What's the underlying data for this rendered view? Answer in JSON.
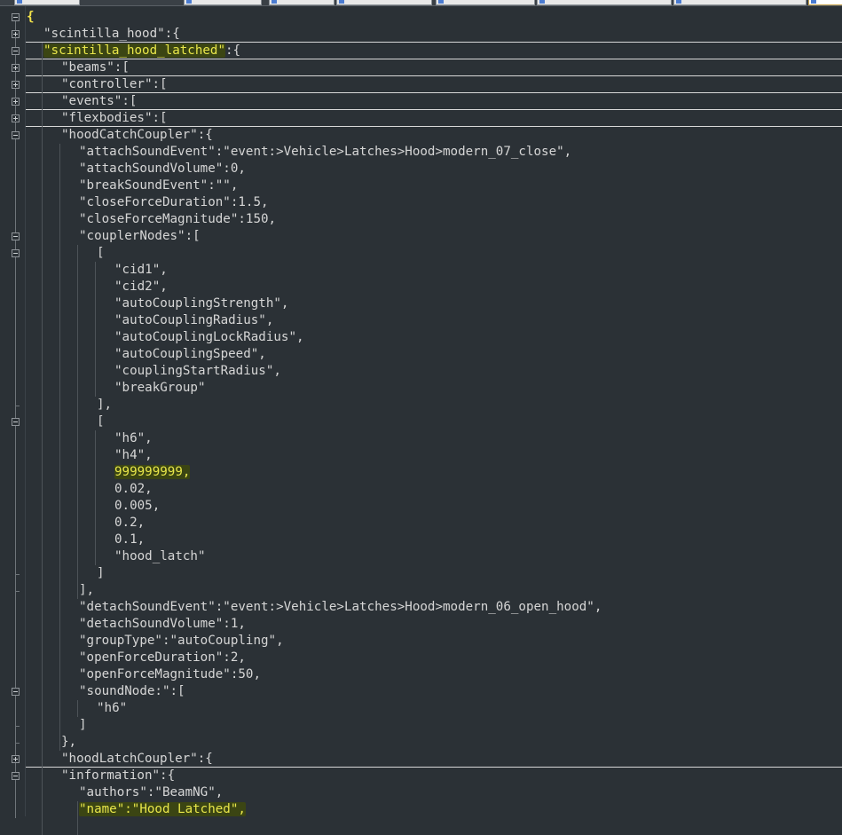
{
  "editor": {
    "lines": [
      {
        "text": "{",
        "indent": 0,
        "fold": "minus",
        "kind": "bracket-match"
      },
      {
        "text": "\"scintilla_hood\":{",
        "indent": 1,
        "fold": "plus"
      },
      {
        "text": "\"scintilla_hood_latched\":{",
        "indent": 1,
        "fold": "minus",
        "highlight": "\"scintilla_hood_latched\"",
        "rest": ":{",
        "boxed": true
      },
      {
        "text": "\"beams\":[",
        "indent": 2,
        "fold": "plus",
        "boxed": true
      },
      {
        "text": "\"controller\":[",
        "indent": 2,
        "fold": "plus",
        "boxed": true
      },
      {
        "text": "\"events\":[",
        "indent": 2,
        "fold": "plus",
        "boxed": true
      },
      {
        "text": "\"flexbodies\":[",
        "indent": 2,
        "fold": "plus",
        "boxed": true
      },
      {
        "text": "\"hoodCatchCoupler\":{",
        "indent": 2,
        "fold": "minus",
        "boxed": true
      },
      {
        "text": "\"attachSoundEvent\":\"event:>Vehicle>Latches>Hood>modern_07_close\",",
        "indent": 3
      },
      {
        "text": "\"attachSoundVolume\":0,",
        "indent": 3
      },
      {
        "text": "\"breakSoundEvent\":\"\",",
        "indent": 3
      },
      {
        "text": "\"closeForceDuration\":1.5,",
        "indent": 3
      },
      {
        "text": "\"closeForceMagnitude\":150,",
        "indent": 3
      },
      {
        "text": "\"couplerNodes\":[",
        "indent": 3,
        "fold": "minus"
      },
      {
        "text": "[",
        "indent": 4,
        "fold": "minus"
      },
      {
        "text": "\"cid1\",",
        "indent": 5
      },
      {
        "text": "\"cid2\",",
        "indent": 5
      },
      {
        "text": "\"autoCouplingStrength\",",
        "indent": 5
      },
      {
        "text": "\"autoCouplingRadius\",",
        "indent": 5
      },
      {
        "text": "\"autoCouplingLockRadius\",",
        "indent": 5
      },
      {
        "text": "\"autoCouplingSpeed\",",
        "indent": 5
      },
      {
        "text": "\"couplingStartRadius\",",
        "indent": 5
      },
      {
        "text": "\"breakGroup\"",
        "indent": 5
      },
      {
        "text": "],",
        "indent": 4,
        "fold": "end"
      },
      {
        "text": "[",
        "indent": 4,
        "fold": "minus"
      },
      {
        "text": "\"h6\",",
        "indent": 5
      },
      {
        "text": "\"h4\",",
        "indent": 5
      },
      {
        "text": "999999999,",
        "indent": 5,
        "highlight": "999999999,",
        "rest": ""
      },
      {
        "text": "0.02,",
        "indent": 5
      },
      {
        "text": "0.005,",
        "indent": 5
      },
      {
        "text": "0.2,",
        "indent": 5
      },
      {
        "text": "0.1,",
        "indent": 5
      },
      {
        "text": "\"hood_latch\"",
        "indent": 5
      },
      {
        "text": "]",
        "indent": 4,
        "fold": "end"
      },
      {
        "text": "],",
        "indent": 3,
        "fold": "end"
      },
      {
        "text": "\"detachSoundEvent\":\"event:>Vehicle>Latches>Hood>modern_06_open_hood\",",
        "indent": 3
      },
      {
        "text": "\"detachSoundVolume\":1,",
        "indent": 3
      },
      {
        "text": "\"groupType\":\"autoCoupling\",",
        "indent": 3
      },
      {
        "text": "\"openForceDuration\":2,",
        "indent": 3
      },
      {
        "text": "\"openForceMagnitude\":50,",
        "indent": 3
      },
      {
        "text": "\"soundNode:\":[",
        "indent": 3,
        "fold": "minus"
      },
      {
        "text": "\"h6\"",
        "indent": 4
      },
      {
        "text": "]",
        "indent": 3,
        "fold": "end"
      },
      {
        "text": "},",
        "indent": 2,
        "fold": "end"
      },
      {
        "text": "\"hoodLatchCoupler\":{",
        "indent": 2,
        "fold": "plus"
      },
      {
        "text": "\"information\":{",
        "indent": 2,
        "fold": "minus",
        "boxed": true
      },
      {
        "text": "\"authors\":\"BeamNG\",",
        "indent": 3
      },
      {
        "text": "\"name\":\"Hood Latched\",",
        "indent": 3,
        "highlight": "\"name\":\"Hood Latched\",",
        "rest": ""
      }
    ]
  },
  "colors": {
    "background": "#2b3136",
    "text": "#d6d6d6",
    "highlight_bg": "#3b4513",
    "highlight_text": "#e8e64a"
  },
  "icons": {
    "fold_open": "fold-minus-icon",
    "fold_closed": "fold-plus-icon"
  }
}
